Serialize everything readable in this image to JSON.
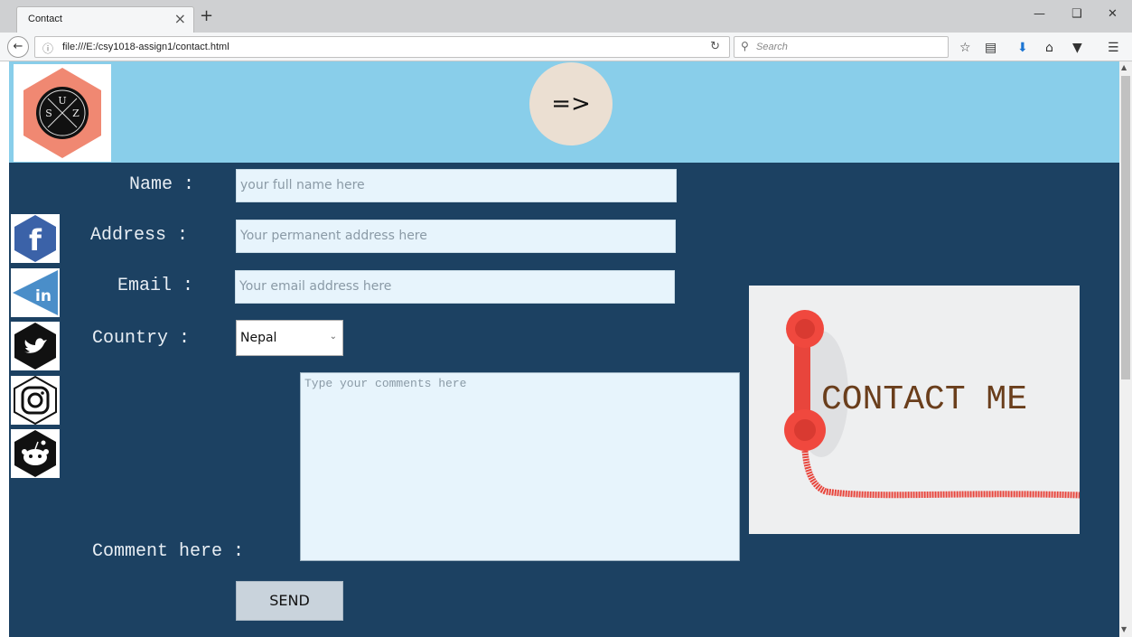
{
  "browser": {
    "tab_title": "Contact",
    "tab_close": "×",
    "new_tab": "+",
    "url": "file:///E:/csy1018-assign1/contact.html",
    "search_placeholder": "Search",
    "window_controls": [
      "minimize-icon",
      "restore-icon",
      "close-icon"
    ],
    "toolbar_icons": [
      "star-icon",
      "reading-list-icon",
      "download-icon",
      "home-icon",
      "pocket-icon",
      "menu-icon"
    ]
  },
  "header": {
    "logo_letters": [
      "S",
      "U",
      "Z"
    ],
    "next_button_label": "=>",
    "colors": {
      "header_bg": "#89ceea",
      "logo_hex": "#f08872"
    }
  },
  "social_icons": [
    "facebook-icon",
    "linkedin-icon",
    "twitter-icon",
    "instagram-icon",
    "reddit-icon"
  ],
  "form": {
    "name_label": "Name :",
    "name_placeholder": "your full name here",
    "address_label": "Address :",
    "address_placeholder": "Your permanent address here",
    "email_label": "Email :",
    "email_placeholder": "Your email address here",
    "country_label": "Country :",
    "country_value": "Nepal",
    "comment_label": "Comment here :",
    "comment_placeholder": "Type your comments here",
    "send_label": "SEND",
    "colors": {
      "main_bg": "#1c4162",
      "field_bg": "#e7f4fc"
    }
  },
  "contact_image": {
    "text": "CONTACT ME"
  }
}
